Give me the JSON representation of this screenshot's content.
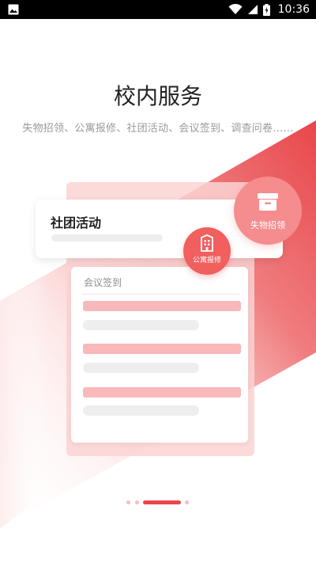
{
  "status_bar": {
    "time": "10:36",
    "icons": [
      "image-icon",
      "wifi-icon",
      "signal-icon",
      "battery-charging-icon"
    ]
  },
  "page": {
    "title": "校内服务",
    "subtitle": "失物招领、公寓报修、社团活动、会议签到、调查问卷……"
  },
  "illustration": {
    "club_card_title": "社团活动",
    "sign_card_title": "会议签到",
    "lost_found_label": "失物招领",
    "apartment_repair_label": "公寓报修",
    "lost_found_icon": "archive-box-icon",
    "apartment_icon": "building-icon"
  },
  "pager": {
    "page_count": 4,
    "active_index": 2
  },
  "colors": {
    "accent": "#e8464a",
    "accent_light": "#f58c8d",
    "panel_pink": "#fcd3d4",
    "bar_pink": "#f9b8ba"
  }
}
